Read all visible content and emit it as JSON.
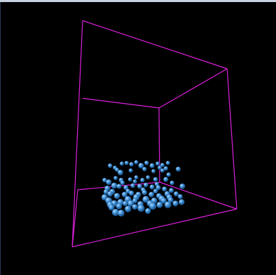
{
  "colors": {
    "background": "#000000",
    "box_edges": "#e020e0",
    "sphere": "#3d8fd6",
    "sphere_highlight": "#b9dcff",
    "sphere_shadow": "#14477a",
    "top_strip": "#c9d2e3"
  },
  "scene": {
    "type": "3d-particle-box-view",
    "particle_count": 90,
    "particle_shape": "sphere"
  }
}
